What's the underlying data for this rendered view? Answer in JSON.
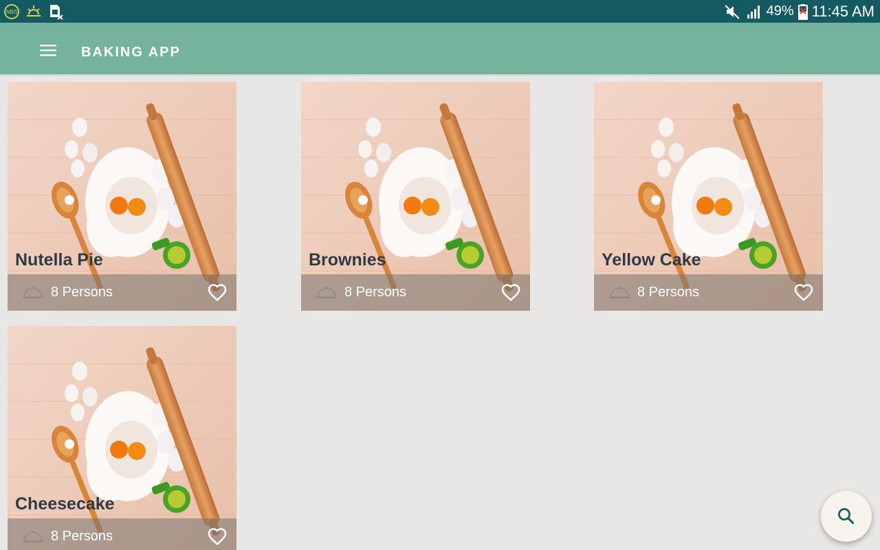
{
  "status_bar": {
    "left_icons": [
      "nbs-badge-icon",
      "sunrise-icon",
      "sim-card-x-icon"
    ],
    "battery_percent": "49%",
    "time": "11:45 AM"
  },
  "toolbar": {
    "title": "BAKING APP",
    "menu_icon": "hamburger-menu-icon"
  },
  "recipes": [
    {
      "name": "Nutella Pie",
      "servings": "8 Persons"
    },
    {
      "name": "Brownies",
      "servings": "8 Persons"
    },
    {
      "name": "Yellow Cake",
      "servings": "8 Persons"
    },
    {
      "name": "Cheesecake",
      "servings": "8 Persons"
    }
  ],
  "fab": {
    "icon": "search-icon"
  },
  "colors": {
    "status_bar": "#145a63",
    "toolbar": "#75b39c",
    "background": "#e9e7e5",
    "recipe_title": "#2e3a44",
    "fab_icon": "#1c5a66"
  }
}
